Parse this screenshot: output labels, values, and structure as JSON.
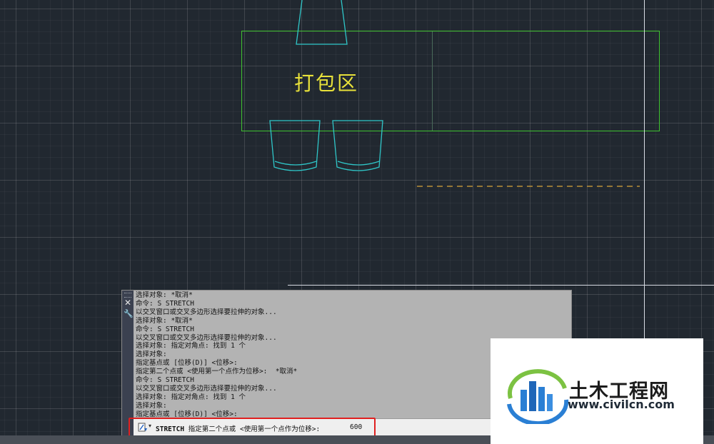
{
  "colors": {
    "background": "#212830",
    "furniture": "#2fc6c8",
    "zone_outline": "#3ec22f",
    "zone_label": "#e8e13a",
    "dashed_line": "#d9a53a",
    "highlight": "#e02020"
  },
  "drawing": {
    "zone_label": "打包区"
  },
  "command_window": {
    "close_icon": "close-icon",
    "settings_icon": "wrench-icon",
    "history": [
      "选择对象: *取消*",
      "命令: S STRETCH",
      "以交叉窗口或交叉多边形选择要拉伸的对象...",
      "选择对象: *取消*",
      "命令: S STRETCH",
      "以交叉窗口或交叉多边形选择要拉伸的对象...",
      "选择对象: 指定对角点: 找到 1 个",
      "选择对象:",
      "指定基点或 [位移(D)] <位移>:",
      "指定第二个点或 <使用第一个点作为位移>:  *取消*",
      "命令: S STRETCH",
      "以交叉窗口或交叉多边形选择要拉伸的对象...",
      "选择对象: 指定对角点: 找到 1 个",
      "选择对象:",
      "指定基点或 [位移(D)] <位移>:"
    ],
    "prompt": {
      "icon": "command-line-icon",
      "command": "STRETCH",
      "text": "指定第二个点或 <使用第一个点作为位移>:",
      "value": "600"
    }
  },
  "watermark": {
    "logo_icon": "building-logo-icon",
    "name": "土木工程网",
    "url": "www.civilcn.com"
  }
}
